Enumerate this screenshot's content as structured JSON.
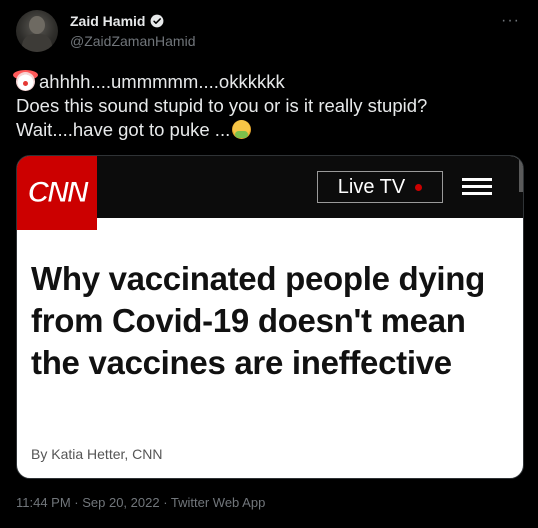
{
  "tweet": {
    "author_name": "Zaid Hamid",
    "author_handle": "@ZaidZamanHamid",
    "line1": "ahhhh....ummmmm....okkkkkk",
    "line2": "Does this sound stupid to you or is it really stupid?",
    "line3": "Wait....have got to puke ...",
    "emoji_start": "clown-face",
    "emoji_end": "face-vomiting",
    "timestamp": "11:44 PM · Sep 20, 2022 · Twitter Web App"
  },
  "card": {
    "logo": "CNN",
    "live_tv": "Live TV",
    "headline": "Why vaccinated people dying from Covid-19 doesn't mean the vaccines are ineffective",
    "byline": "By Katia Hetter, CNN"
  },
  "colors": {
    "background": "#000000",
    "text": "#e7e9ea",
    "muted": "#71767b",
    "verified": "#1d9bf0",
    "cnn_red": "#cc0000"
  }
}
